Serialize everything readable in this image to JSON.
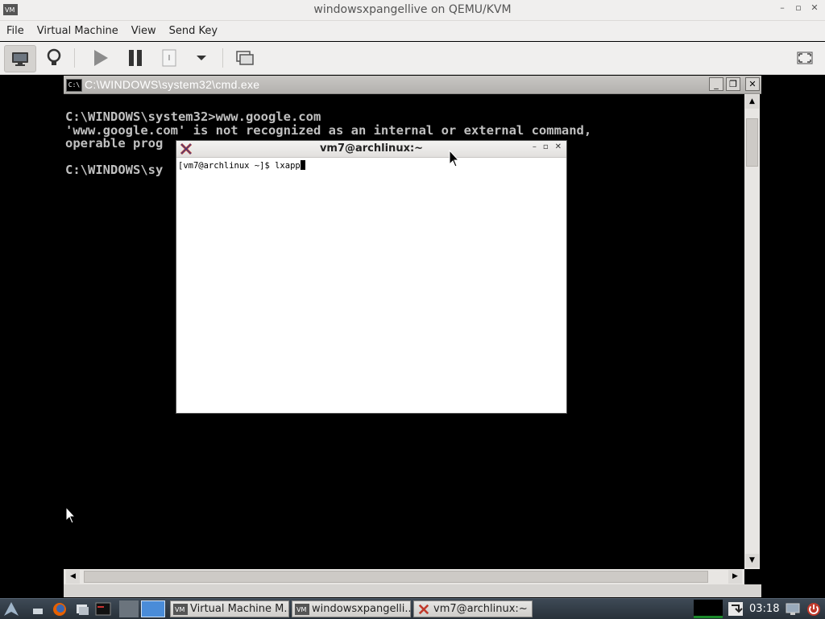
{
  "window": {
    "title": "windowsxpangellive on QEMU/KVM",
    "controls": [
      "–",
      "▫",
      "✕"
    ]
  },
  "menu": [
    "File",
    "Virtual Machine",
    "View",
    "Send Key"
  ],
  "toolbar": {
    "buttons": [
      "monitor-icon",
      "lightbulb-icon",
      "play-icon",
      "pause-icon",
      "power-icon",
      "chevron-down-icon",
      "screenshot-icon",
      "fullscreen-icon"
    ]
  },
  "cmd": {
    "title": "C:\\WINDOWS\\system32\\cmd.exe",
    "icon_text": "C:\\",
    "lines": [
      "C:\\WINDOWS\\system32>www.google.com",
      "'www.google.com' is not recognized as an internal or external command,",
      "operable prog",
      "",
      "C:\\WINDOWS\\sy"
    ],
    "btn_min": "_",
    "btn_max": "❐",
    "btn_close": "✕",
    "arrow_up": "▲",
    "arrow_down": "▼",
    "arrow_left": "◀",
    "arrow_right": "▶"
  },
  "xterm": {
    "title": "vm7@archlinux:~",
    "prompt": "[vm7@archlinux ~]$ lxapp",
    "btn_min": "–",
    "btn_max": "▫",
    "btn_close": "✕"
  },
  "taskbar": {
    "tasks": [
      {
        "label": "Virtual Machine M...",
        "icon": "vm-icon"
      },
      {
        "label": "windowsxpangelli...",
        "icon": "vm-icon"
      },
      {
        "label": "vm7@archlinux:~",
        "icon": "xterm-icon"
      }
    ],
    "clock": "03:18"
  },
  "colors": {
    "chrome": "#f0efee",
    "taskbar": "#2f3942",
    "console_text": "#c0c0c0"
  }
}
